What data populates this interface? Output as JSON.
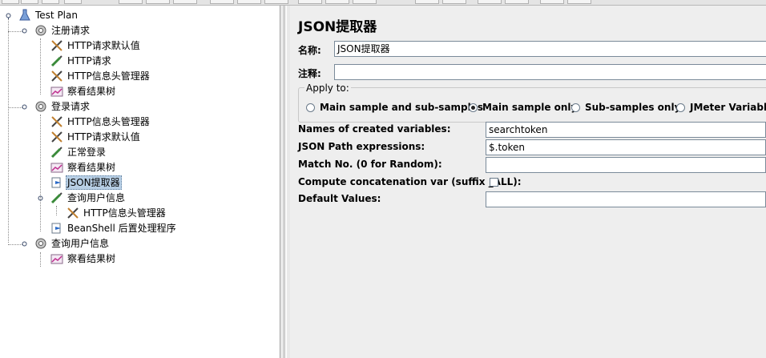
{
  "tree": {
    "root": {
      "label": "Test Plan",
      "icon": "flask-icon"
    },
    "nodes": [
      {
        "label": "注册请求",
        "icon": "gear-icon"
      },
      {
        "label": "HTTP请求默认值",
        "icon": "wrench-icon"
      },
      {
        "label": "HTTP请求",
        "icon": "pipette-icon"
      },
      {
        "label": "HTTP信息头管理器",
        "icon": "wrench-icon"
      },
      {
        "label": "察看结果树",
        "icon": "chart-icon"
      },
      {
        "label": "登录请求",
        "icon": "gear-icon"
      },
      {
        "label": "HTTP信息头管理器",
        "icon": "wrench-icon"
      },
      {
        "label": "HTTP请求默认值",
        "icon": "wrench-icon"
      },
      {
        "label": "正常登录",
        "icon": "pipette-icon"
      },
      {
        "label": "察看结果树",
        "icon": "chart-icon"
      },
      {
        "label": "JSON提取器",
        "icon": "extractor-icon",
        "selected": true
      },
      {
        "label": "查询用户信息",
        "icon": "pipette-icon"
      },
      {
        "label": "HTTP信息头管理器",
        "icon": "wrench-icon"
      },
      {
        "label": "BeanShell 后置处理程序",
        "icon": "extractor-icon"
      },
      {
        "label": "查询用户信息",
        "icon": "gear-icon"
      },
      {
        "label": "察看结果树",
        "icon": "chart-icon"
      }
    ]
  },
  "form": {
    "title": "JSON提取器",
    "name_label": "名称:",
    "name_value": "JSON提取器",
    "comment_label": "注释:",
    "comment_value": "",
    "apply_to": {
      "title": "Apply to:",
      "options": [
        "Main sample and sub-samples",
        "Main sample only",
        "Sub-samples only",
        "JMeter Variable N"
      ],
      "selected_index": 1
    },
    "fields": {
      "var_names_label": "Names of created variables:",
      "var_names_value": "searchtoken",
      "json_path_label": "JSON Path expressions:",
      "json_path_value": "$.token",
      "match_no_label": "Match No. (0 for Random):",
      "match_no_value": "",
      "concat_label": "Compute concatenation var (suffix _ALL):",
      "concat_checked": false,
      "default_label": "Default Values:",
      "default_value": ""
    }
  }
}
